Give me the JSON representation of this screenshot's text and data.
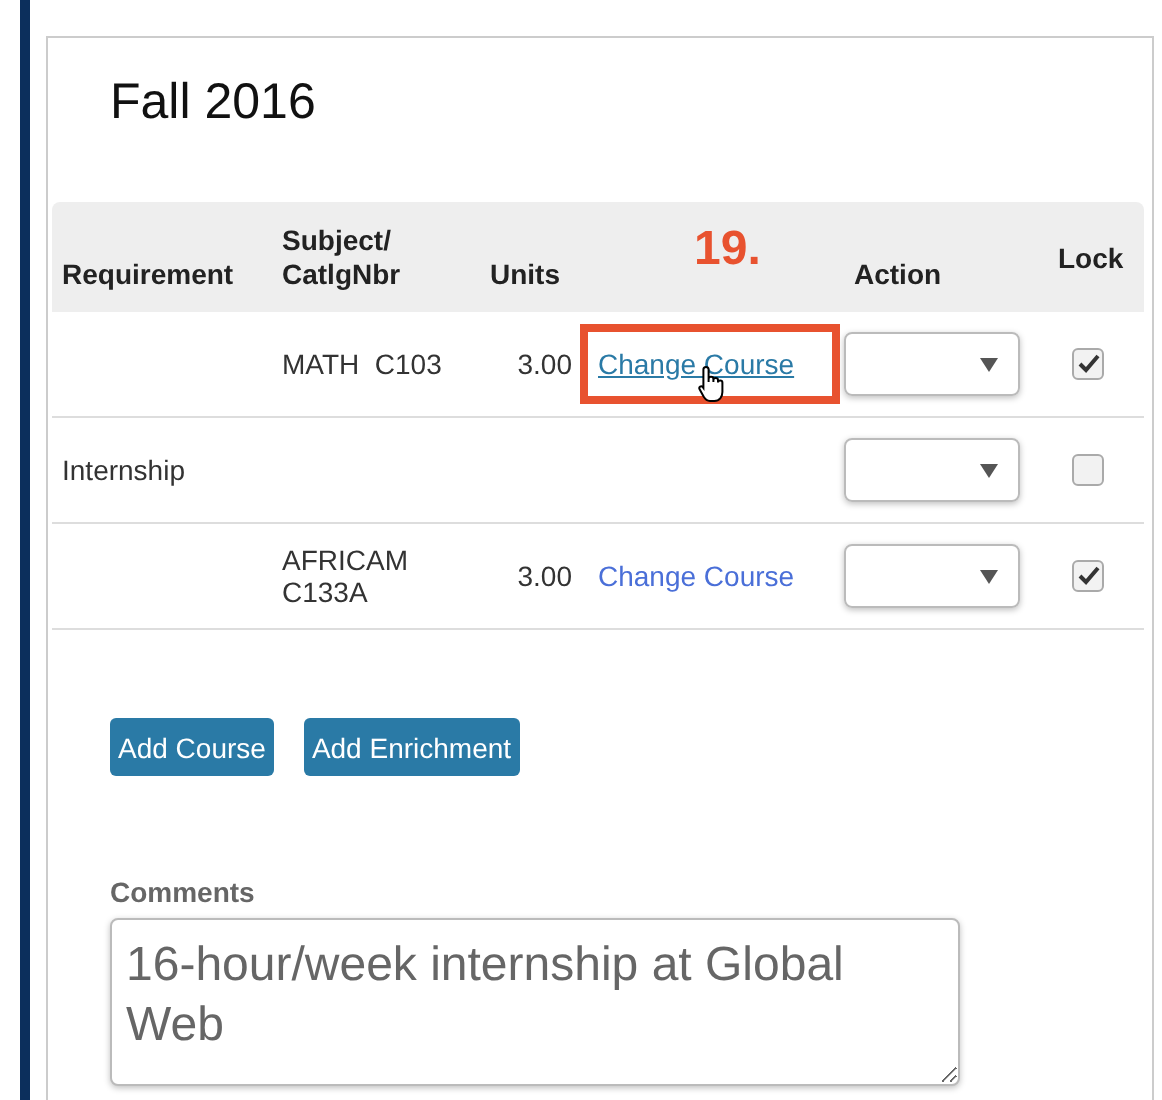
{
  "term": {
    "title": "Fall 2016"
  },
  "callout": {
    "label": "19."
  },
  "table": {
    "columns": [
      "Requirement",
      "Subject/\nCatlgNbr",
      "Units",
      "",
      "Action",
      "Lock"
    ],
    "rows": [
      {
        "requirement": "",
        "subject": "MATH  C103",
        "units": "3.00",
        "link": "Change Course",
        "highlighted": true,
        "hovered": true,
        "locked": true
      },
      {
        "requirement": "Internship",
        "subject": "",
        "units": "",
        "link": "",
        "highlighted": false,
        "hovered": false,
        "locked": false
      },
      {
        "requirement": "",
        "subject": "AFRICAM\nC133A",
        "units": "3.00",
        "link": "Change Course",
        "highlighted": false,
        "hovered": false,
        "locked": true
      }
    ]
  },
  "buttons": [
    "Add Course",
    "Add Enrichment"
  ],
  "comments": {
    "label": "Comments",
    "value": "16-hour/week internship at Global Web"
  }
}
